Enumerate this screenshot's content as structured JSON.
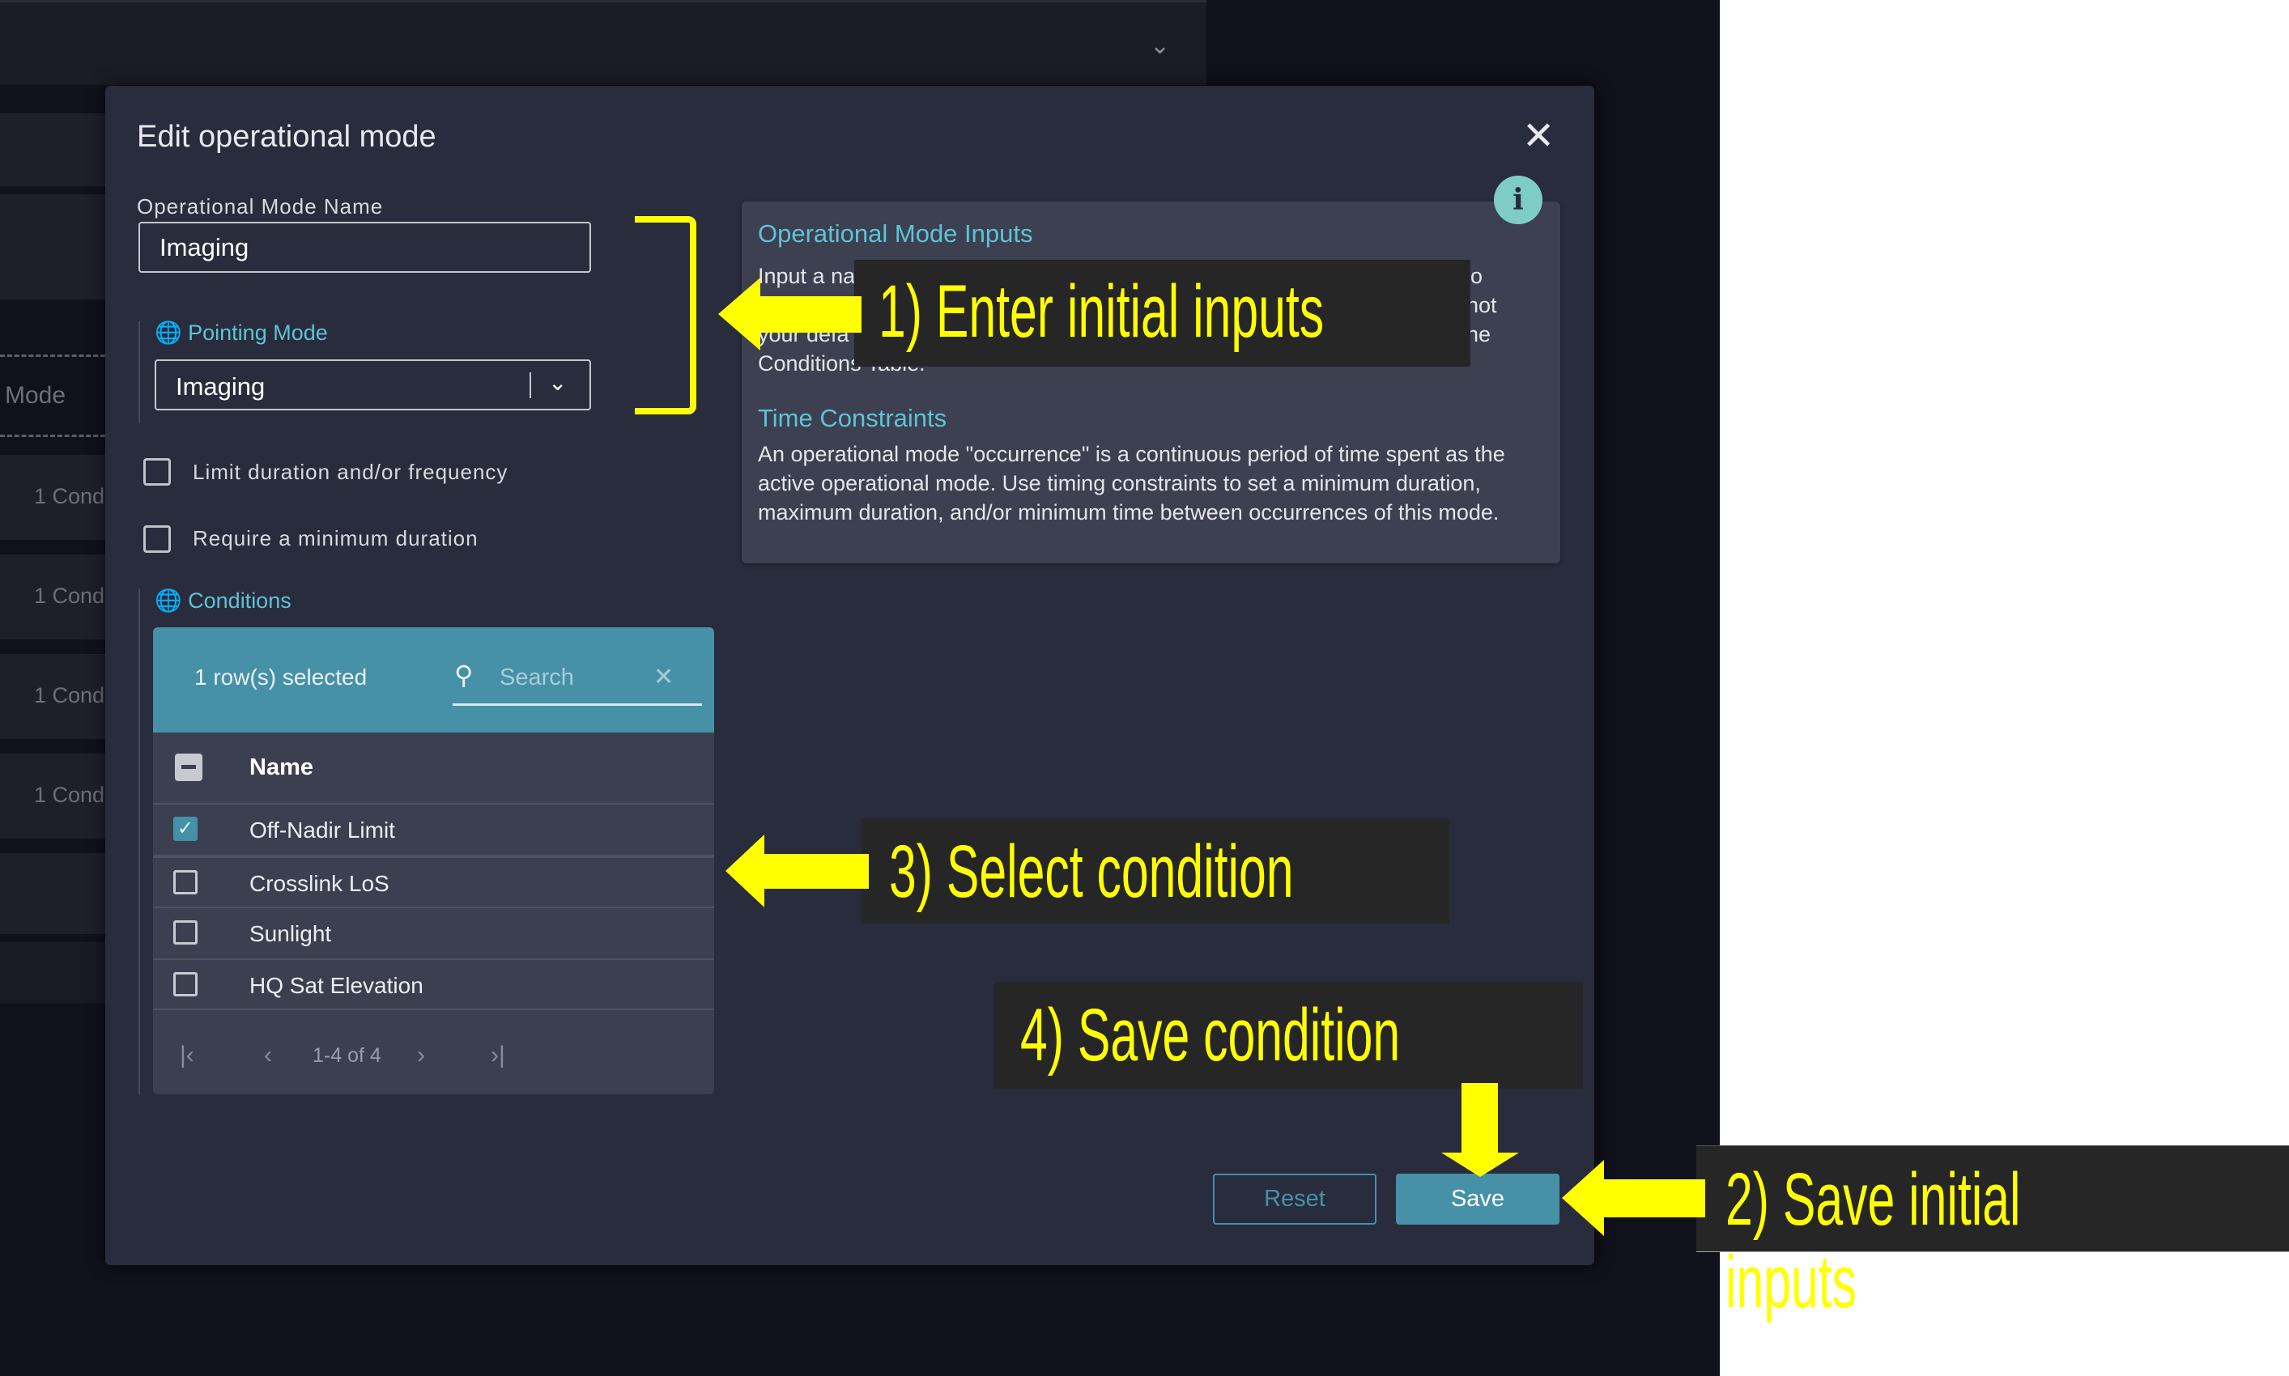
{
  "background": {
    "row_label": "Mode",
    "row_values": [
      "1 Cond",
      "1 Cond",
      "1 Cond",
      "1 Cond"
    ]
  },
  "dialog": {
    "title": "Edit operational mode",
    "name_label": "Operational Mode Name",
    "name_value": "Imaging",
    "pointing_label": "Pointing Mode",
    "pointing_value": "Imaging",
    "checkboxes": [
      {
        "label": "Limit duration and/or frequency",
        "checked": false
      },
      {
        "label": "Require a minimum duration",
        "checked": false
      }
    ],
    "conditions_label": "Conditions",
    "table": {
      "selected_text": "1 row(s) selected",
      "search_placeholder": "Search",
      "column": "Name",
      "rows": [
        {
          "name": "Off-Nadir Limit",
          "checked": true
        },
        {
          "name": "Crosslink LoS",
          "checked": false
        },
        {
          "name": "Sunlight",
          "checked": false
        },
        {
          "name": "HQ Sat Elevation",
          "checked": false
        }
      ],
      "pagination": "1-4 of 4"
    },
    "info": {
      "heading1": "Operational Mode Inputs",
      "para1_fragments": [
        "Input a na",
        "o",
        "not",
        "your defa",
        "ne",
        "Conditions Table."
      ],
      "heading2": "Time Constraints",
      "para2": "An operational mode \"occurrence\" is a continuous period of time spent as the active operational mode. Use timing constraints to set a minimum duration, maximum duration, and/or minimum time between occurrences of this mode."
    },
    "reset_label": "Reset",
    "save_label": "Save"
  },
  "annotations": {
    "step1": "1) Enter initial inputs",
    "step2_line1": "2) Save initial",
    "step2_line2": "inputs",
    "step3": "3) Select condition",
    "step4": "4) Save condition",
    "color": "#ffff00"
  },
  "colors": {
    "accent": "#4690a8",
    "teal_text": "#5ec3d5",
    "dialog_bg": "#292c3c",
    "info_icon": "#7ecdc4"
  }
}
